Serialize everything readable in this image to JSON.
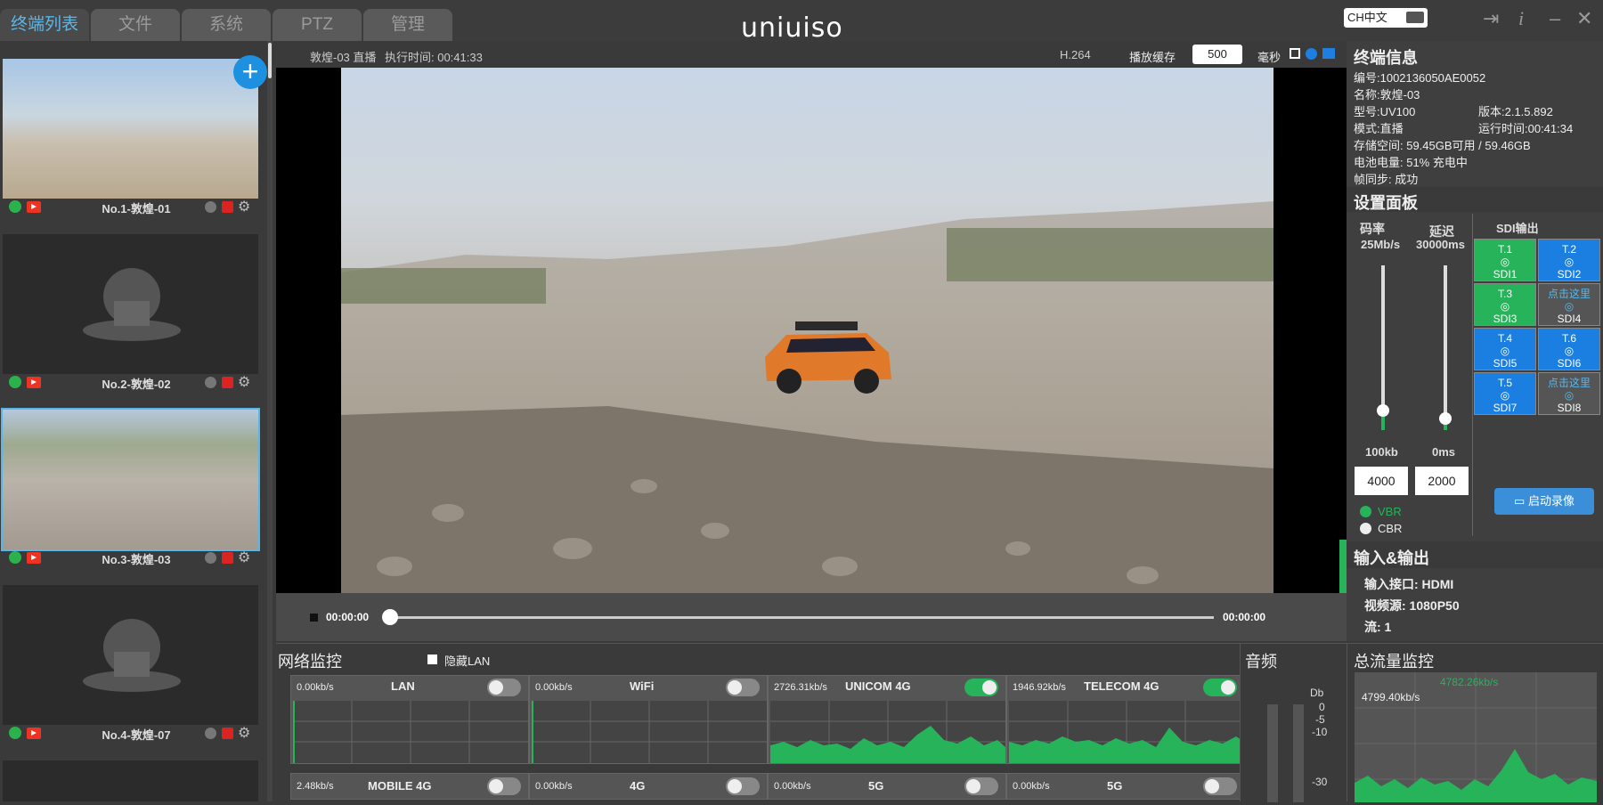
{
  "tabs": [
    "终端列表",
    "文件",
    "系统",
    "PTZ",
    "管理"
  ],
  "logo": "uniuiso",
  "lang": "CH中文",
  "terminals": [
    {
      "label": "No.1-敦煌-01"
    },
    {
      "label": "No.2-敦煌-02"
    },
    {
      "label": "No.3-敦煌-03"
    },
    {
      "label": "No.4-敦煌-07"
    }
  ],
  "video": {
    "title": "敦煌-03 直播",
    "exec_time": "执行时间: 00:41:33",
    "codec": "H.264",
    "buffer_label": "播放缓存",
    "buffer_value": "500",
    "buffer_unit": "毫秒",
    "time_start": "00:00:00",
    "time_end": "00:00:00"
  },
  "terminal_info": {
    "title": "终端信息",
    "id": "编号:1002136050AE0052",
    "name": "名称:敦煌-03",
    "model": "型号:UV100",
    "version": "版本:2.1.5.892",
    "mode": "模式:直播",
    "uptime": "运行时间:00:41:34",
    "storage": "存储空间:  59.45GB可用 / 59.46GB",
    "battery": "电池电量: 51% 充电中",
    "sync": "帧同步: 成功"
  },
  "settings": {
    "title": "设置面板",
    "bitrate_label": "码率",
    "bitrate_max": "25Mb/s",
    "bitrate_min": "100kb",
    "bitrate_value": "4000",
    "bitrate_level": 0.12,
    "delay_label": "延迟",
    "delay_max": "30000ms",
    "delay_min": "0ms",
    "delay_value": "2000",
    "delay_level": 0.07,
    "vbr": "VBR",
    "cbr": "CBR",
    "sdi_title": "SDI输出",
    "sdi": [
      {
        "top": "T.1",
        "bottom": "SDI1",
        "color": "green"
      },
      {
        "top": "T.2",
        "bottom": "SDI2",
        "color": "blue"
      },
      {
        "top": "T.3",
        "bottom": "SDI3",
        "color": "green"
      },
      {
        "top": "点击这里",
        "bottom": "SDI4",
        "color": "gray"
      },
      {
        "top": "T.4",
        "bottom": "SDI5",
        "color": "blue"
      },
      {
        "top": "T.6",
        "bottom": "SDI6",
        "color": "blue"
      },
      {
        "top": "T.5",
        "bottom": "SDI7",
        "color": "blue"
      },
      {
        "top": "点击这里",
        "bottom": "SDI8",
        "color": "gray"
      }
    ],
    "record_button": "启动录像"
  },
  "io": {
    "title": "输入&输出",
    "input": "输入接口: HDMI",
    "source": "视频源: 1080P50",
    "stream": "流: 1"
  },
  "network": {
    "title": "网络监控",
    "hide_lan": "隐藏LAN",
    "links": [
      {
        "name": "LAN",
        "rate": "0.00kb/s",
        "on": false
      },
      {
        "name": "WiFi",
        "rate": "0.00kb/s",
        "on": false
      },
      {
        "name": "UNICOM 4G",
        "rate": "2726.31kb/s",
        "on": true
      },
      {
        "name": "TELECOM 4G",
        "rate": "1946.92kb/s",
        "on": true
      },
      {
        "name": "MOBILE 4G",
        "rate": "2.48kb/s",
        "on": false
      },
      {
        "name": "4G",
        "rate": "0.00kb/s",
        "on": false
      },
      {
        "name": "5G",
        "rate": "0.00kb/s",
        "on": false
      },
      {
        "name": "5G",
        "rate": "0.00kb/s",
        "on": false
      }
    ]
  },
  "audio": {
    "title": "音频",
    "unit": "Db",
    "ticks": [
      "0",
      "-5",
      "-10",
      "-30"
    ]
  },
  "traffic": {
    "title": "总流量监控",
    "peak": "4782.26kb/s",
    "current": "4799.40kb/s"
  }
}
